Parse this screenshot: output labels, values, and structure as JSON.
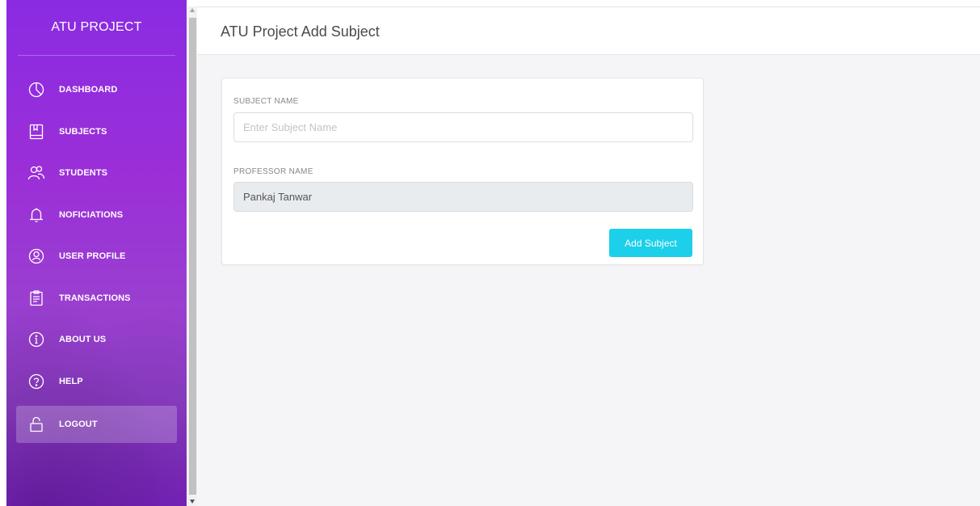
{
  "sidebar": {
    "brand": "ATU PROJECT",
    "items": [
      {
        "label": "DASHBOARD",
        "icon": "dashboard-icon"
      },
      {
        "label": "SUBJECTS",
        "icon": "book-icon"
      },
      {
        "label": "STUDENTS",
        "icon": "users-icon"
      },
      {
        "label": "NOFICIATIONS",
        "icon": "bell-icon"
      },
      {
        "label": "USER PROFILE",
        "icon": "user-icon"
      },
      {
        "label": "TRANSACTIONS",
        "icon": "clipboard-icon"
      },
      {
        "label": "ABOUT US",
        "icon": "info-icon"
      },
      {
        "label": "HELP",
        "icon": "help-icon"
      },
      {
        "label": "LOGOUT",
        "icon": "lock-icon",
        "active": true
      }
    ]
  },
  "header": {
    "title": "ATU Project Add Subject"
  },
  "form": {
    "subject_label": "SUBJECT NAME",
    "subject_placeholder": "Enter Subject Name",
    "subject_value": "",
    "professor_label": "PROFESSOR NAME",
    "professor_value": "Pankaj Tanwar",
    "submit_label": "Add Subject"
  },
  "colors": {
    "sidebar_purple": "#9b2fd8",
    "button_cyan": "#1ccfea",
    "content_bg": "#f5f5f7"
  }
}
